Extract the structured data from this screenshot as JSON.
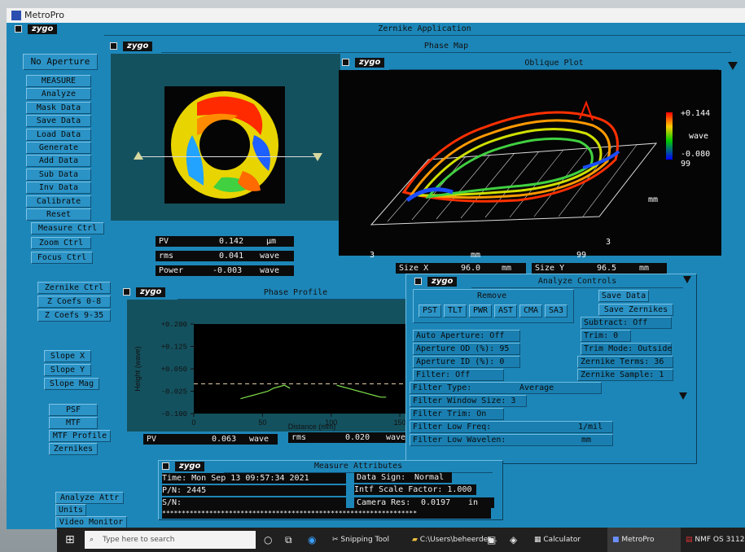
{
  "window": {
    "title": "MetroPro"
  },
  "main": {
    "title": "Zernike Application",
    "aperture": "No Aperture"
  },
  "sidebar": {
    "buttons": [
      "MEASURE",
      "Analyze",
      "Mask Data",
      "Save Data",
      "Load Data",
      "Generate",
      "Add Data",
      "Sub Data",
      "Inv Data",
      "Calibrate",
      "Reset"
    ],
    "ctrls": [
      "Measure Ctrl",
      "Zoom  Ctrl",
      "Focus Ctrl"
    ],
    "zernike": [
      "Zernike Ctrl",
      "Z Coefs 0-8",
      "Z Coefs 9-35"
    ],
    "slope": [
      "Slope X",
      "Slope Y",
      "Slope Mag"
    ],
    "misc": [
      "PSF",
      "MTF",
      "MTF Profile",
      "Zernikes"
    ],
    "bottom": [
      "Analyze Attr",
      "Units",
      "Video Monitor"
    ]
  },
  "brand": "zygo",
  "phase_map": {
    "title": "Phase Map",
    "pv": {
      "label": "PV",
      "value": "0.142",
      "unit": "µm"
    },
    "rms": {
      "label": "rms",
      "value": "0.041",
      "unit": "wave"
    },
    "power": {
      "label": "Power",
      "value": "-0.003",
      "unit": "wave"
    }
  },
  "oblique": {
    "title": "Oblique Plot",
    "scale_max": "+0.144",
    "scale_unit": "wave",
    "scale_min": "-0.080",
    "y_max": "99",
    "y_unit": "mm",
    "y_min": "3",
    "x_min": "3",
    "x_unit": "mm",
    "x_max": "99",
    "size_x": {
      "label": "Size X",
      "value": "96.0",
      "unit": "mm"
    },
    "size_y": {
      "label": "Size Y",
      "value": "96.5",
      "unit": "mm"
    }
  },
  "profile": {
    "title": "Phase Profile",
    "pv": {
      "label": "PV",
      "value": "0.063",
      "unit": "wave"
    },
    "rms": {
      "label": "rms",
      "value": "0.020",
      "unit": "wave"
    }
  },
  "chart_data": {
    "type": "line",
    "xlabel": "Distance (mm)",
    "ylabel": "Height (wave)",
    "xlim": [
      0,
      160
    ],
    "ylim": [
      -0.1,
      0.2
    ],
    "xticks": [
      "0",
      "50",
      "100",
      "150"
    ],
    "yticks": [
      "+0.200",
      "+0.125",
      "+0.050",
      "-0.025",
      "-0.100"
    ],
    "series": [
      {
        "x": [
          34,
          38,
          42,
          46,
          50,
          54,
          58,
          62,
          66,
          70
        ],
        "y": [
          -0.05,
          -0.045,
          -0.04,
          -0.035,
          -0.03,
          -0.025,
          -0.015,
          -0.01,
          -0.005,
          -0.015
        ]
      },
      {
        "x": [
          104,
          108,
          112,
          116,
          120,
          124,
          128,
          132,
          136,
          140
        ],
        "y": [
          -0.005,
          -0.01,
          -0.015,
          -0.02,
          -0.025,
          -0.03,
          -0.035,
          -0.04,
          -0.045,
          -0.045
        ]
      }
    ]
  },
  "analyze": {
    "title": "Analyze Controls",
    "remove_label": "Remove",
    "remove_options": [
      "PST",
      "TLT",
      "PWR",
      "AST",
      "CMA",
      "SA3"
    ],
    "save_data": "Save Data",
    "save_zernikes": "Save Zernikes",
    "subtract": "Subtract:   Off",
    "trim": "Trim:   0",
    "trim_mode": "Trim Mode: Outside",
    "zernike_terms": "Zernike Terms:  36",
    "zernike_sample": "Zernike Sample:  1",
    "auto_aperture": "Auto Aperture:  Off",
    "aperture_od": "Aperture OD (%):  95",
    "aperture_id": "Aperture ID (%):   0",
    "filter": "Filter:      Off",
    "filter_type": {
      "label": "Filter Type:",
      "value": "Average"
    },
    "filter_window": "Filter Window Size:  3",
    "filter_trim": "Filter Trim:  On",
    "filter_low_freq": {
      "label": "Filter Low Freq:",
      "value": "1/mil"
    },
    "filter_low_wavelen": {
      "label": "Filter Low Wavelen:",
      "value": "mm"
    }
  },
  "attributes": {
    "title": "Measure Attributes",
    "time": "Time: Mon Sep 13 09:57:34 2021",
    "pn": "P/N: 2445",
    "sn": "S/N:",
    "data_sign": {
      "label": "Data Sign:",
      "value": "Normal"
    },
    "intf": "Intf Scale Factor: 1.000",
    "camera": {
      "label": "Camera Res:",
      "value": "0.0197",
      "unit": "in"
    },
    "stars": "*****************************************************************"
  },
  "taskbar": {
    "search": "Type here to search",
    "items": [
      "Snipping Tool",
      "C:\\Users\\beheerder...",
      "Calculator",
      "MetroPro",
      "NMF OS 3112"
    ]
  },
  "colors": {
    "panel": "#1d86b8",
    "field": "#0b0b0b"
  }
}
